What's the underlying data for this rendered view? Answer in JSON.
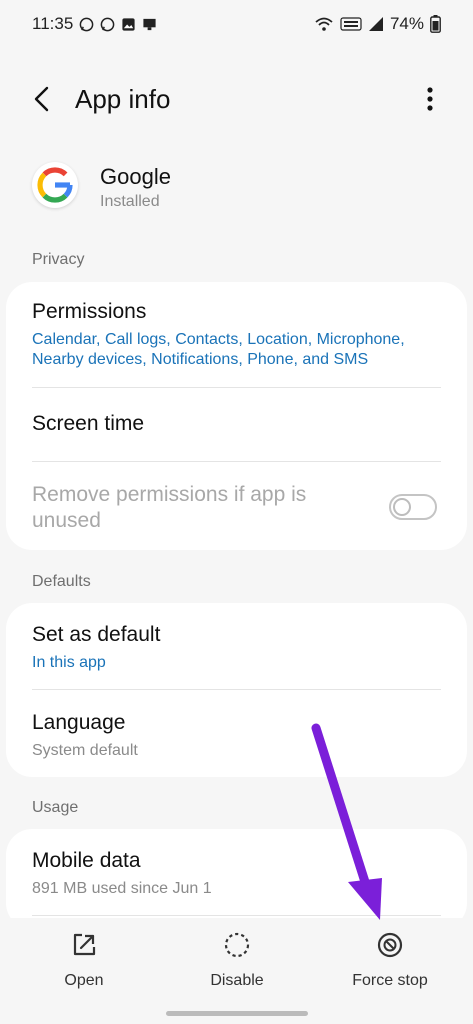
{
  "status_bar": {
    "time": "11:35",
    "battery": "74%"
  },
  "header": {
    "title": "App info"
  },
  "app": {
    "name": "Google",
    "status": "Installed"
  },
  "sections": {
    "privacy": "Privacy",
    "defaults": "Defaults",
    "usage": "Usage"
  },
  "privacy": {
    "permissions_title": "Permissions",
    "permissions_sub_line1": "Calendar, Call logs, Contacts, Location, Microphone,",
    "permissions_sub_line2": "Nearby devices, Notifications, Phone, and SMS",
    "screen_time": "Screen time",
    "remove_permissions_line1": "Remove permissions if app is",
    "remove_permissions_line2": "unused"
  },
  "defaults": {
    "set_default_title": "Set as default",
    "set_default_sub": "In this app",
    "language_title": "Language",
    "language_sub": "System default"
  },
  "usage": {
    "mobile_data_title": "Mobile data",
    "mobile_data_sub": "891 MB used since Jun 1"
  },
  "bottom": {
    "open": "Open",
    "disable": "Disable",
    "force_stop": "Force stop"
  },
  "colors": {
    "link_blue": "#1a73b8",
    "annotation_arrow": "#7b1fd9"
  },
  "icons": {
    "back": "back-arrow-icon",
    "more": "more-vertical-icon",
    "open": "open-external-icon",
    "disable": "disable-dashed-circle-icon",
    "force_stop": "force-stop-icon"
  }
}
